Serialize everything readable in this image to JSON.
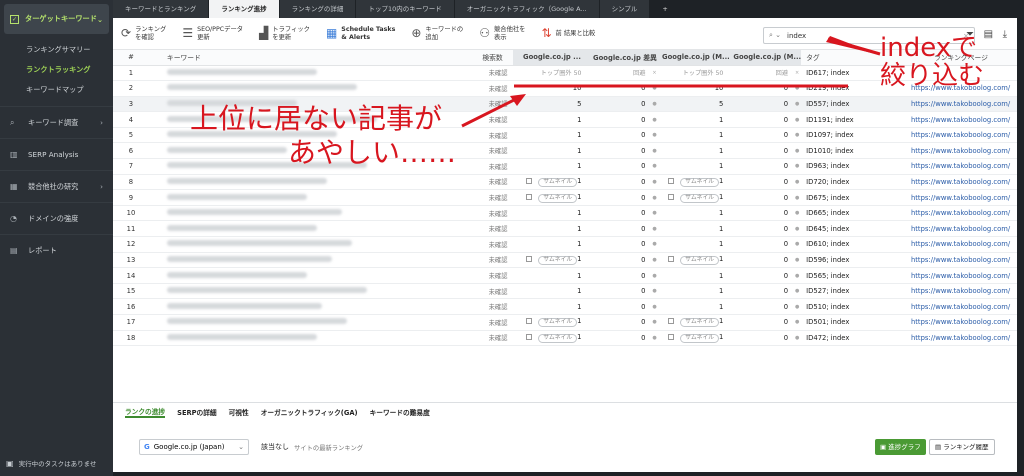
{
  "sidebar": {
    "section_title": "ターゲットキーワード",
    "subitems": [
      "ランキングサマリー",
      "ランクトラッキング",
      "キーワードマップ"
    ],
    "items": [
      "キーワード調査",
      "SERP Analysis",
      "競合他社の研究",
      "ドメインの強度",
      "レポート"
    ],
    "bottom_status": "実行中のタスクはありませ"
  },
  "tabs": [
    "キーワードとランキング",
    "ランキング進捗",
    "ランキングの詳細",
    "トップ10内のキーワード",
    "オーガニックトラフィック（Google A...",
    "シンプル",
    "+"
  ],
  "toolbar": {
    "b1": [
      "ランキング",
      "を確認"
    ],
    "b2": [
      "SEO/PPCデータ",
      "更新"
    ],
    "b3": [
      "トラフィック",
      "を更新"
    ],
    "b4": [
      "Schedule Tasks",
      "& Alerts"
    ],
    "b5": [
      "キーワードの",
      "追加"
    ],
    "b6": [
      "競合他社を",
      "表示"
    ],
    "b7": "前 結果と比較",
    "search_value": "index"
  },
  "table": {
    "headers": [
      "#",
      "キーワード",
      "検索数",
      "Google.co.jp ...",
      "Google.co.jp 差異",
      "Google.co.jp (M...",
      "Google.co.jp (M...",
      "タグ",
      "ランキングページ"
    ],
    "status_label": "未確認",
    "rows": [
      {
        "no": "1",
        "r1": "トップ圏外 50",
        "d1": "回避",
        "r2": "トップ圏外 50",
        "d2": "回避",
        "tag": "ID617; index",
        "url": "",
        "thumb": false
      },
      {
        "no": "2",
        "r1": "10",
        "d1": "0",
        "r2": "10",
        "d2": "0",
        "tag": "ID219; index",
        "url": "https://www.takoboolog.com/",
        "thumb": false
      },
      {
        "no": "3",
        "r1": "5",
        "d1": "0",
        "r2": "5",
        "d2": "0",
        "tag": "ID557; index",
        "url": "https://www.takoboolog.com/",
        "thumb": false
      },
      {
        "no": "4",
        "r1": "1",
        "d1": "0",
        "r2": "1",
        "d2": "0",
        "tag": "ID1191; index",
        "url": "https://www.takoboolog.com/",
        "thumb": false
      },
      {
        "no": "5",
        "r1": "1",
        "d1": "0",
        "r2": "1",
        "d2": "0",
        "tag": "ID1097; index",
        "url": "https://www.takoboolog.com/",
        "thumb": false
      },
      {
        "no": "6",
        "r1": "1",
        "d1": "0",
        "r2": "1",
        "d2": "0",
        "tag": "ID1010; index",
        "url": "https://www.takoboolog.com/",
        "thumb": false
      },
      {
        "no": "7",
        "r1": "1",
        "d1": "0",
        "r2": "1",
        "d2": "0",
        "tag": "ID963; index",
        "url": "https://www.takoboolog.com/",
        "thumb": false
      },
      {
        "no": "8",
        "r1": "1",
        "d1": "0",
        "r2": "1",
        "d2": "0",
        "tag": "ID720; index",
        "url": "https://www.takoboolog.com/",
        "thumb": true
      },
      {
        "no": "9",
        "r1": "1",
        "d1": "0",
        "r2": "1",
        "d2": "0",
        "tag": "ID675; index",
        "url": "https://www.takoboolog.com/",
        "thumb": true
      },
      {
        "no": "10",
        "r1": "1",
        "d1": "0",
        "r2": "1",
        "d2": "0",
        "tag": "ID665; index",
        "url": "https://www.takoboolog.com/",
        "thumb": false
      },
      {
        "no": "11",
        "r1": "1",
        "d1": "0",
        "r2": "1",
        "d2": "0",
        "tag": "ID645; index",
        "url": "https://www.takoboolog.com/",
        "thumb": false
      },
      {
        "no": "12",
        "r1": "1",
        "d1": "0",
        "r2": "1",
        "d2": "0",
        "tag": "ID610; index",
        "url": "https://www.takoboolog.com/",
        "thumb": false
      },
      {
        "no": "13",
        "r1": "1",
        "d1": "0",
        "r2": "1",
        "d2": "0",
        "tag": "ID596; index",
        "url": "https://www.takoboolog.com/",
        "thumb": true
      },
      {
        "no": "14",
        "r1": "1",
        "d1": "0",
        "r2": "1",
        "d2": "0",
        "tag": "ID565; index",
        "url": "https://www.takoboolog.com/",
        "thumb": false
      },
      {
        "no": "15",
        "r1": "1",
        "d1": "0",
        "r2": "1",
        "d2": "0",
        "tag": "ID527; index",
        "url": "https://www.takoboolog.com/",
        "thumb": false
      },
      {
        "no": "16",
        "r1": "1",
        "d1": "0",
        "r2": "1",
        "d2": "0",
        "tag": "ID510; index",
        "url": "https://www.takoboolog.com/",
        "thumb": false
      },
      {
        "no": "17",
        "r1": "1",
        "d1": "0",
        "r2": "1",
        "d2": "0",
        "tag": "ID501; index",
        "url": "https://www.takoboolog.com/",
        "thumb": true
      },
      {
        "no": "18",
        "r1": "1",
        "d1": "0",
        "r2": "1",
        "d2": "0",
        "tag": "ID472; index",
        "url": "https://www.takoboolog.com/",
        "thumb": true
      }
    ],
    "thumb_label": "サムネイル"
  },
  "bottom": {
    "tabs": [
      "ランクの進捗",
      "SERPの詳細",
      "可視性",
      "オーガニックトラフィック(GA)",
      "キーワードの難易度"
    ],
    "engine": "Google.co.jp (Japan)",
    "not_found": "該当なし",
    "not_found_sub": "サイトの最新ランキング",
    "graph_btn": "進捗グラフ",
    "history_btn": "ランキング履歴"
  },
  "annotations": {
    "filter_note": [
      "indexで",
      "絞り込む"
    ],
    "main_note": [
      "上位に居ない記事が",
      "あやしい……"
    ]
  },
  "colors": {
    "annotation": "#d8161f",
    "accent_green": "#9fd356",
    "sidebar_bg": "#2b3036"
  }
}
